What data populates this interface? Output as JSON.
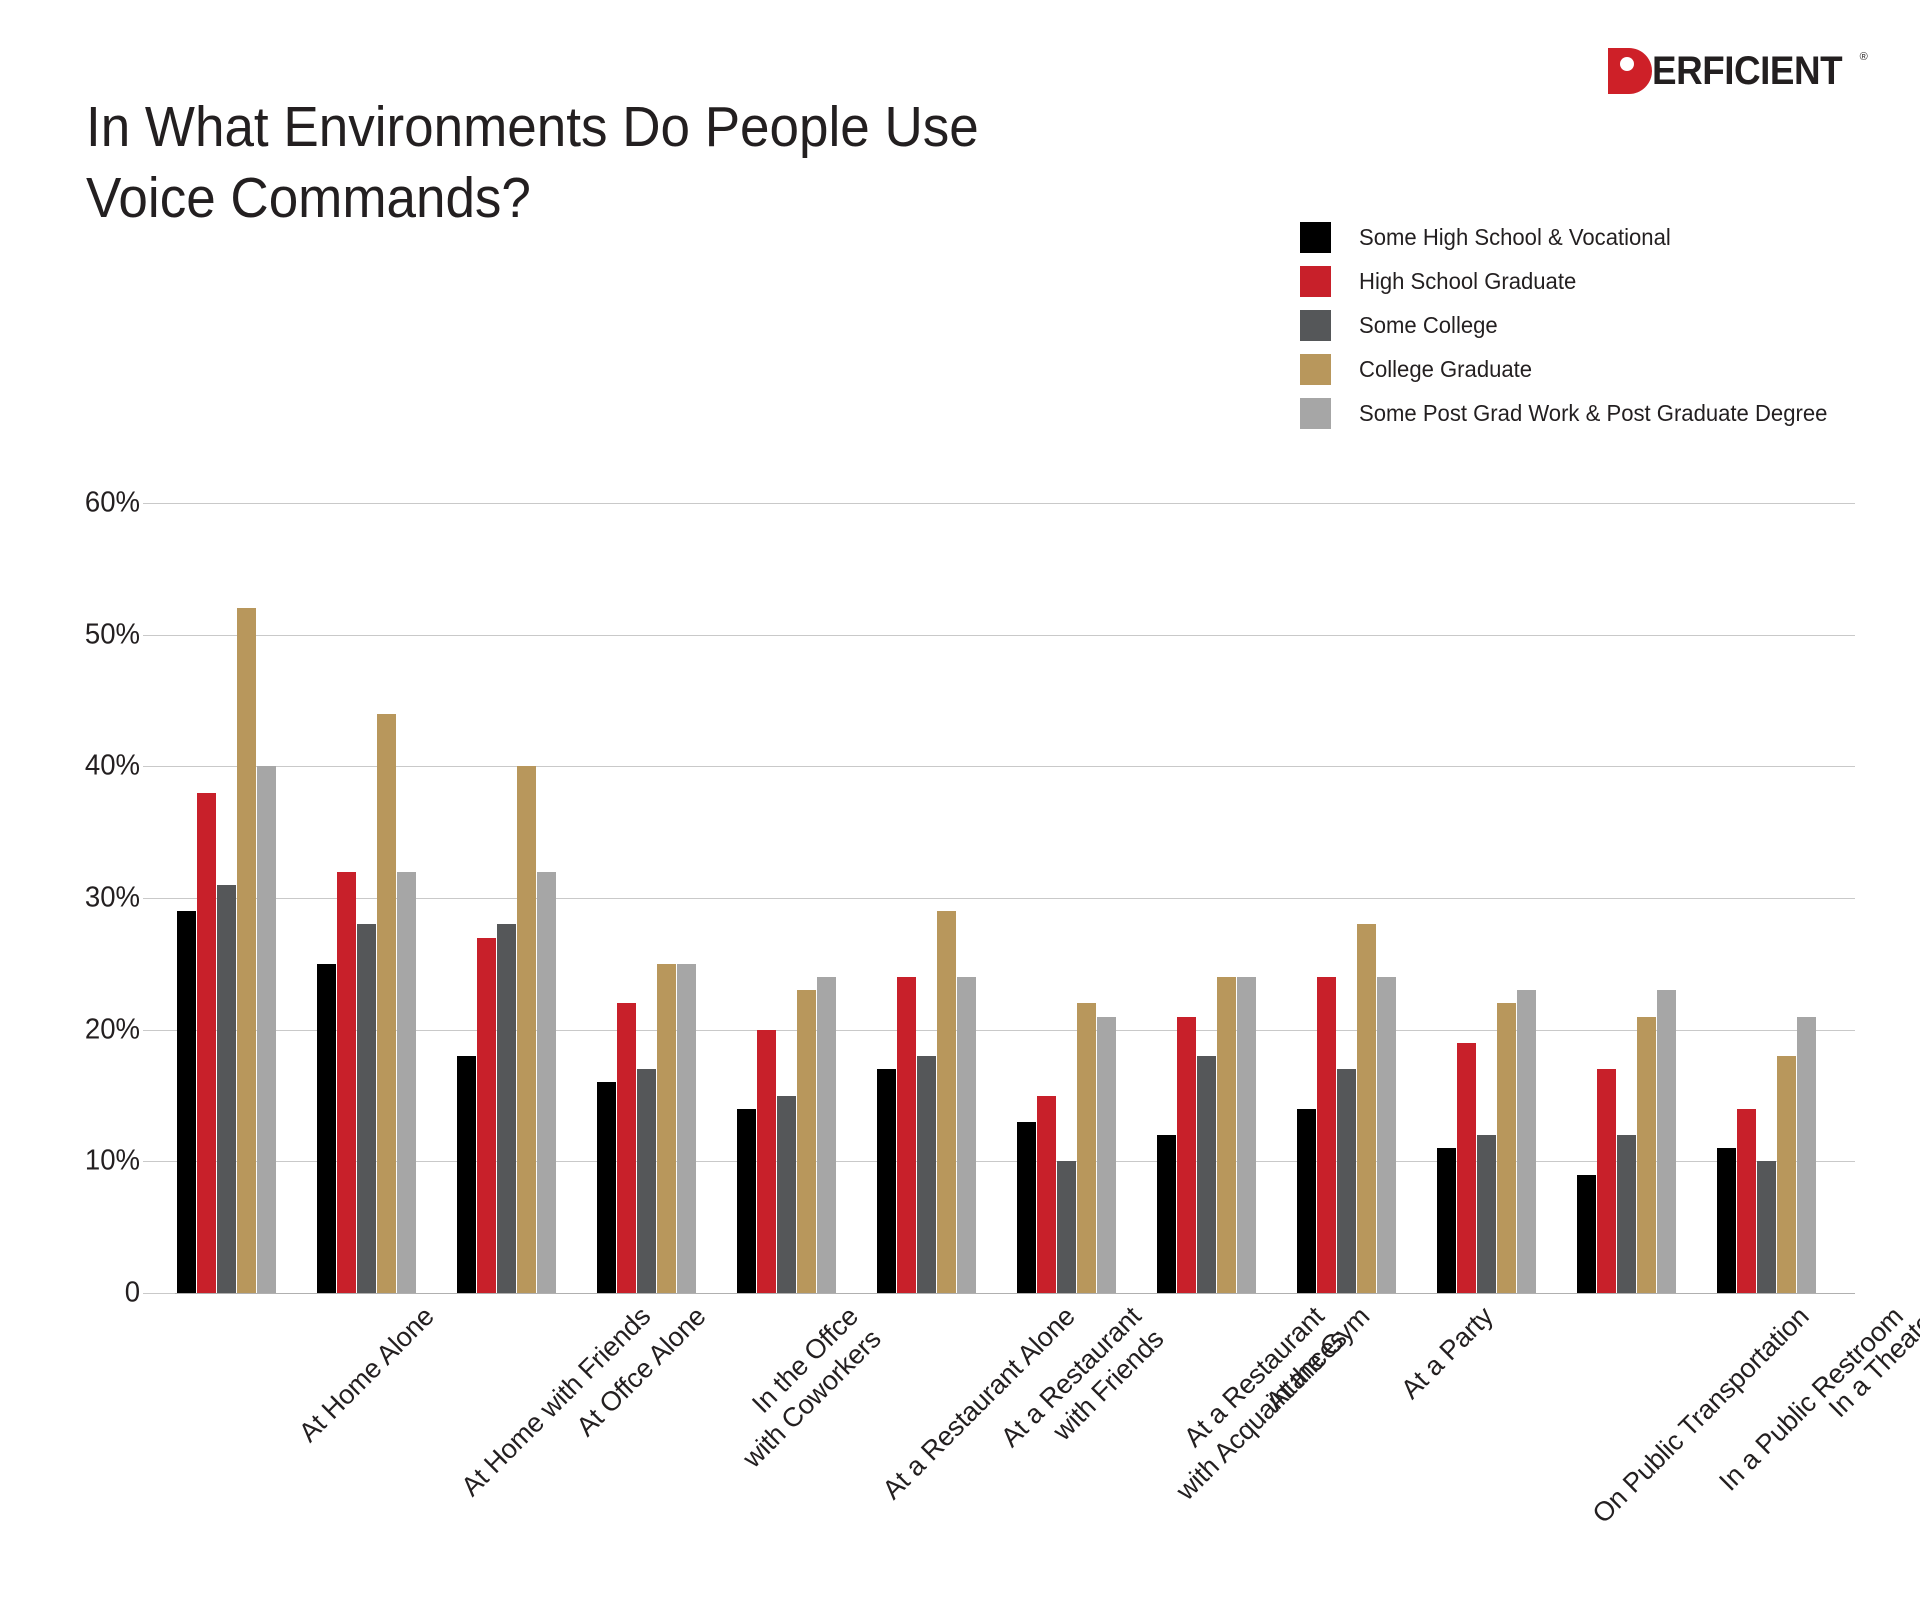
{
  "brand": {
    "logo_mark": "P",
    "logo_word": "ERFICIENT",
    "logo_registered": "®",
    "red": "#CE2028"
  },
  "title": "In What Environments Do People Use Voice Commands?",
  "legend": {
    "items": [
      {
        "label": "Some High School & Vocational",
        "color": "#000000"
      },
      {
        "label": "High School Graduate",
        "color": "#C8202A"
      },
      {
        "label": "Some College",
        "color": "#555759"
      },
      {
        "label": "College Graduate",
        "color": "#B8975C"
      },
      {
        "label": "Some Post Grad Work & Post Graduate Degree",
        "color": "#A6A6A6"
      }
    ]
  },
  "chart_data": {
    "type": "bar",
    "title": "In What Environments Do People Use Voice Commands?",
    "xlabel": "",
    "ylabel": "",
    "ylim": [
      0,
      60
    ],
    "ytick_labels": [
      "60%",
      "50%",
      "40%",
      "30%",
      "20%",
      "10%",
      "0"
    ],
    "ytick_values": [
      60,
      50,
      40,
      30,
      20,
      10,
      0
    ],
    "grid": true,
    "legend_position": "top-right",
    "units": "percent",
    "categories": [
      "At Home Alone",
      "At Home with Friends",
      "At Offce Alone",
      "In the Offce\nwith Coworkers",
      "At a Restaurant Alone",
      "At a Restaurant\nwith Friends",
      "At a Restaurant\nwith Acquaintances",
      "At the Gym",
      "At a Party",
      "On Public Transportation",
      "In a Public Restroom",
      "In a Theater"
    ],
    "series": [
      {
        "name": "Some High School & Vocational",
        "color": "#000000",
        "values": [
          29,
          25,
          18,
          16,
          14,
          17,
          13,
          12,
          14,
          11,
          9,
          11
        ]
      },
      {
        "name": "High School Graduate",
        "color": "#C8202A",
        "values": [
          38,
          32,
          27,
          22,
          20,
          24,
          15,
          21,
          24,
          19,
          17,
          14
        ]
      },
      {
        "name": "Some College",
        "color": "#555759",
        "values": [
          31,
          28,
          28,
          17,
          15,
          18,
          10,
          18,
          17,
          12,
          12,
          10
        ]
      },
      {
        "name": "College Graduate",
        "color": "#B8975C",
        "values": [
          52,
          44,
          40,
          25,
          23,
          29,
          22,
          24,
          28,
          22,
          21,
          18
        ]
      },
      {
        "name": "Some Post Grad Work & Post Graduate Degree",
        "color": "#A6A6A6",
        "values": [
          40,
          32,
          32,
          25,
          24,
          24,
          21,
          24,
          24,
          23,
          23,
          21
        ]
      }
    ]
  }
}
